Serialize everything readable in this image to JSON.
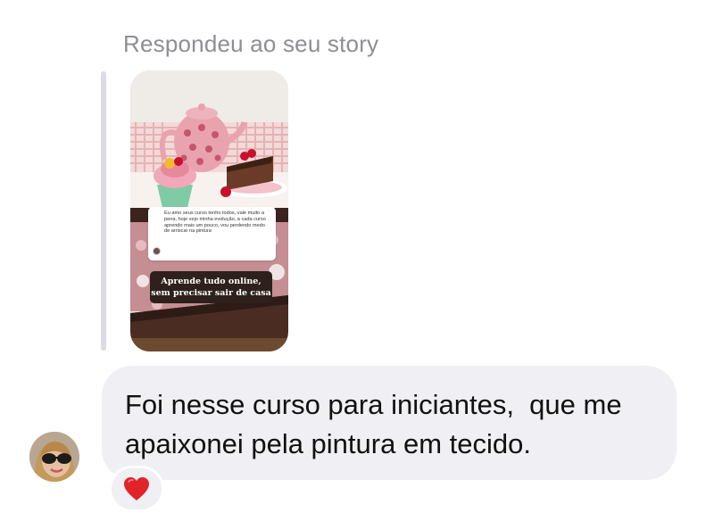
{
  "reply_header": "Respondeu ao seu story",
  "story": {
    "testimonial_text": "Eu amo seus curso tenho todos, vale muito a pena, hoje vejo minha evolução, a cada curso aprendo mais um pouco, vou perdendo medo de arriscar na pintura",
    "caption_line1": "Aprende tudo online,",
    "caption_line2": "sem precisar sair de casa"
  },
  "message": {
    "text": "Foi nesse curso para iniciantes,  que me apaixonei pela pintura em tecido."
  },
  "reaction": {
    "emoji_name": "red-heart-icon",
    "color": "#e0242a"
  },
  "colors": {
    "bubble": "#efeff4",
    "secondary_text": "#8e8e93"
  }
}
